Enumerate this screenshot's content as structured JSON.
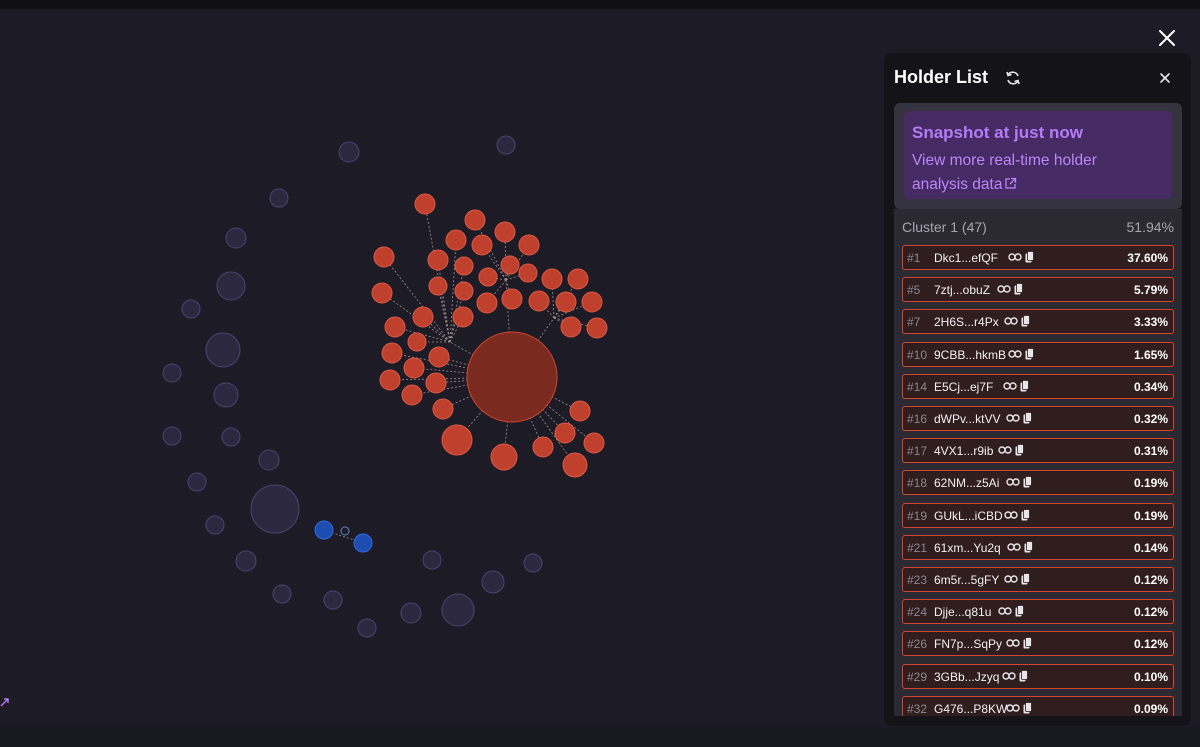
{
  "panel": {
    "title": "Holder List",
    "snapshot_title": "Snapshot at just now",
    "snapshot_link": "View more real-time holder analysis data",
    "cluster_name": "Cluster 1 (47)",
    "cluster_pct": "51.94%"
  },
  "holders": [
    {
      "rank": "#1",
      "addr": "Dkc1...efQF",
      "pct": "37.60%"
    },
    {
      "rank": "#5",
      "addr": "7ztj...obuZ",
      "pct": "5.79%"
    },
    {
      "rank": "#7",
      "addr": "2H6S...r4Px",
      "pct": "3.33%"
    },
    {
      "rank": "#10",
      "addr": "9CBB...hkmB",
      "pct": "1.65%"
    },
    {
      "rank": "#14",
      "addr": "E5Cj...ej7F",
      "pct": "0.34%"
    },
    {
      "rank": "#16",
      "addr": "dWPv...ktVV",
      "pct": "0.32%"
    },
    {
      "rank": "#17",
      "addr": "4VX1...r9ib",
      "pct": "0.31%"
    },
    {
      "rank": "#18",
      "addr": "62NM...z5Ai",
      "pct": "0.19%"
    },
    {
      "rank": "#19",
      "addr": "GUkL...iCBD",
      "pct": "0.19%"
    },
    {
      "rank": "#21",
      "addr": "61xm...Yu2q",
      "pct": "0.14%"
    },
    {
      "rank": "#23",
      "addr": "6m5r...5gFY",
      "pct": "0.12%"
    },
    {
      "rank": "#24",
      "addr": "Djje...q81u",
      "pct": "0.12%"
    },
    {
      "rank": "#26",
      "addr": "FN7p...SqPy",
      "pct": "0.12%"
    },
    {
      "rank": "#29",
      "addr": "3GBb...Jzyq",
      "pct": "0.10%"
    },
    {
      "rank": "#32",
      "addr": "G476...P8KW",
      "pct": "0.09%"
    }
  ],
  "colors": {
    "cluster_fill": "#7a2a1f",
    "cluster_stroke": "#d2452f",
    "other_fill": "#2c2840",
    "other_stroke": "#4a4470",
    "pair_fill": "#1d4db0",
    "accent": "#b57bf7"
  }
}
